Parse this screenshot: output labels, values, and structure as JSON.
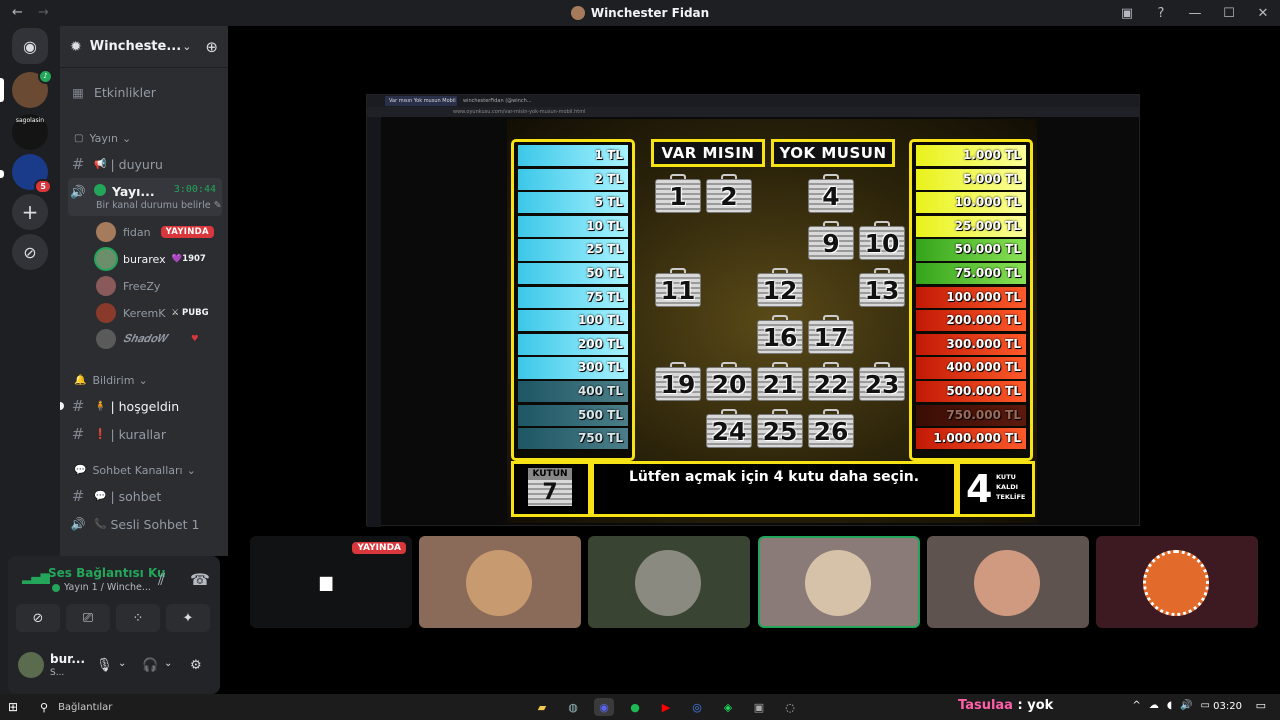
{
  "window": {
    "title": "Winchester Fidan"
  },
  "titlebar": {
    "back": "←",
    "forward": "→",
    "inbox": "▣",
    "help": "?",
    "minimize": "—",
    "maximize": "☐",
    "close": "✕"
  },
  "servers": [
    {
      "id": "discord-home",
      "glyph": "◉"
    },
    {
      "id": "winchester",
      "badge": ""
    },
    {
      "id": "sagolasin",
      "text": "sagolasin"
    },
    {
      "id": "fenerbahce",
      "badge": "5"
    },
    {
      "id": "add-server",
      "glyph": "+"
    },
    {
      "id": "explore",
      "glyph": "⊘"
    }
  ],
  "guild": {
    "name": "Wincheste...",
    "chevron": "⌄",
    "invite": "⊕"
  },
  "channels": {
    "events": {
      "icon": "▦",
      "label": "Etkinlikler"
    },
    "cat_yayin": {
      "icon": "▢",
      "label": "Yayın",
      "chevron": "⌄"
    },
    "duyuru": {
      "icon": "#",
      "emoji": "📢",
      "label": "| duyuru"
    },
    "voice_yayin": {
      "name": "Yayı...",
      "time": "3:00:44",
      "status": "Bir kanal durumu belirle",
      "edit": "✎"
    },
    "members": [
      {
        "name": "fidan",
        "badge": "YAYINDA",
        "color": "#a67b5b"
      },
      {
        "name": "burarex",
        "tag": "💜1907",
        "color": "#6b8e6b"
      },
      {
        "name": "FreeZy",
        "color": "#8a5a5a"
      },
      {
        "name": "KeremK",
        "tag": "⚔ PUBG",
        "color": "#8a3a2a"
      },
      {
        "name": "𝑺𝒉𝒂𝒅𝒐𝑾",
        "tag": "♥",
        "color": "#5a5a5a"
      }
    ],
    "cat_bildirim": {
      "icon": "🔔",
      "label": "Bildirim",
      "chevron": "⌄"
    },
    "hosgeldin": {
      "icon": "#",
      "emoji": "🧍",
      "label": "| hoşgeldin"
    },
    "kurallar": {
      "icon": "#",
      "emoji": "❗",
      "label": "| kurallar"
    },
    "cat_sohbet": {
      "icon": "💬",
      "label": "Sohbet Kanalları",
      "chevron": "⌄"
    },
    "sohbet": {
      "icon": "#",
      "emoji": "💬",
      "label": "| sohbet"
    },
    "sesli": {
      "icon": "🔊",
      "emoji": "📞",
      "label": "Sesli Sohbet 1"
    }
  },
  "voice_panel": {
    "status": "Ses Bağlantısı Ku",
    "sub": "Yayın 1 / Winche...",
    "user_name": "bur...",
    "user_sub": "S..."
  },
  "game": {
    "title_left": "VAR MISIN",
    "title_right": "YOK MUSUN",
    "left_ladder": [
      "1 TL",
      "2 TL",
      "5 TL",
      "10 TL",
      "25 TL",
      "50 TL",
      "75 TL",
      "100 TL",
      "200 TL",
      "300 TL",
      "400 TL",
      "500 TL",
      "750 TL"
    ],
    "left_dim": [
      false,
      false,
      false,
      false,
      false,
      false,
      false,
      false,
      false,
      false,
      true,
      true,
      true
    ],
    "right_ladder": [
      "1.000 TL",
      "5.000 TL",
      "10.000 TL",
      "25.000 TL",
      "50.000 TL",
      "75.000 TL",
      "100.000 TL",
      "200.000 TL",
      "300.000 TL",
      "400.000 TL",
      "500.000 TL",
      "750.000 TL",
      "1.000.000 TL"
    ],
    "right_style": [
      "y",
      "y",
      "y",
      "y",
      "g",
      "g",
      "r",
      "r",
      "r",
      "r",
      "r",
      "r-dim",
      "r"
    ],
    "cases": [
      {
        "n": "1",
        "col": 0,
        "row": 0
      },
      {
        "n": "2",
        "col": 1,
        "row": 0
      },
      {
        "n": "4",
        "col": 3,
        "row": 0
      },
      {
        "n": "9",
        "col": 3,
        "row": 1
      },
      {
        "n": "10",
        "col": 4,
        "row": 1
      },
      {
        "n": "11",
        "col": 0,
        "row": 2
      },
      {
        "n": "12",
        "col": 2,
        "row": 2
      },
      {
        "n": "13",
        "col": 4,
        "row": 2
      },
      {
        "n": "16",
        "col": 2,
        "row": 3
      },
      {
        "n": "17",
        "col": 3,
        "row": 3
      },
      {
        "n": "19",
        "col": 0,
        "row": 4
      },
      {
        "n": "20",
        "col": 1,
        "row": 4
      },
      {
        "n": "21",
        "col": 2,
        "row": 4
      },
      {
        "n": "22",
        "col": 3,
        "row": 4
      },
      {
        "n": "23",
        "col": 4,
        "row": 4
      },
      {
        "n": "24",
        "col": 1,
        "row": 5
      },
      {
        "n": "25",
        "col": 2,
        "row": 5
      },
      {
        "n": "26",
        "col": 3,
        "row": 5
      }
    ],
    "kutu_label": "KUTUN",
    "kutu_number": "7",
    "message": "Lütfen açmak için 4 kutu daha seçin.",
    "offer_number": "4",
    "offer_label": "KUTU\nKALDI\nTEKLİFE"
  },
  "browser": {
    "tab1": "Var mısın Yok musun Mobil",
    "tab2": "winchesterFidan (@winch...",
    "url": "www.oyunkusu.com/var-misin-yok-musun-mobil.html"
  },
  "tiles": [
    {
      "bg": "#111214",
      "live": "YAYINDA",
      "screen": true
    },
    {
      "bg": "#8a6a58",
      "avatar": "#c89a70"
    },
    {
      "bg": "#3a4432",
      "avatar": "#8a8a80"
    },
    {
      "bg": "#8a7a78",
      "avatar": "#d6c2a8",
      "speaking": true
    },
    {
      "bg": "#5e534e",
      "avatar": "#d09a80"
    },
    {
      "bg": "#3d1a22",
      "avatar": "#e26a2a"
    }
  ],
  "taskbar": {
    "search_label": "Bağlantılar",
    "game_name": "Tasulaa",
    "game_sep": " : ",
    "game_value": "yok",
    "tray": [
      "^",
      "☁",
      "◖",
      "🔊",
      "▭"
    ],
    "clock": "03:20"
  },
  "colors": {
    "accent_green": "#23a55a",
    "live_red": "#da373c",
    "game_yellow": "#f6e215"
  }
}
